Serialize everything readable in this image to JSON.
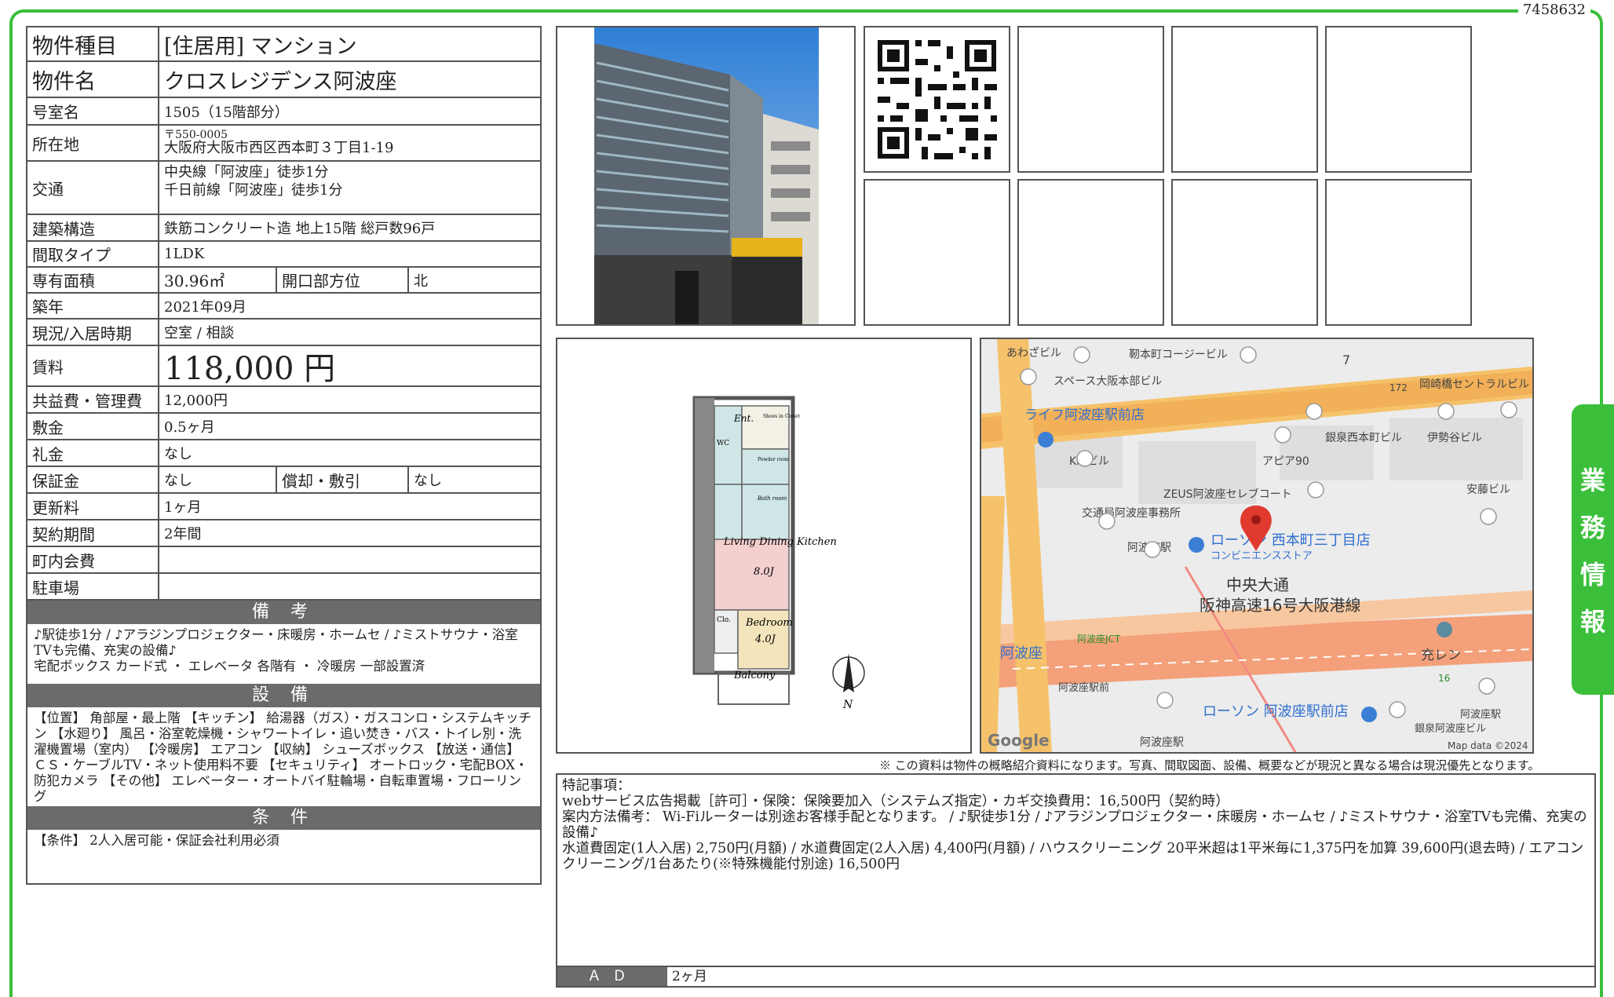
{
  "doc_id": "7458632",
  "side_tab": [
    "業",
    "務",
    "情",
    "報"
  ],
  "property": {
    "type_label": "物件種目",
    "type_value": "[住居用]  マンション",
    "name_label": "物件名",
    "name_value": "クロスレジデンス阿波座",
    "room_label": "号室名",
    "room_value": "1505（15階部分）",
    "address_label": "所在地",
    "postal": "〒550-0005",
    "address_value": "大阪府大阪市西区西本町３丁目1-19",
    "access_label": "交通",
    "access_1": "中央線「阿波座」徒歩1分",
    "access_2": "千日前線「阿波座」徒歩1分",
    "structure_label": "建築構造",
    "structure_value": "鉄筋コンクリート造  地上15階  総戸数96戸",
    "layout_label": "間取タイプ",
    "layout_value": "1LDK",
    "area_label": "専有面積",
    "area_value": "30.96㎡",
    "direction_label": "開口部方位",
    "direction_value": "北",
    "built_label": "築年",
    "built_value": "2021年09月",
    "status_label": "現況/入居時期",
    "status_value": "空室  /  相談",
    "rent_label": "賃料",
    "rent_value": "118,000  円",
    "fee_label": "共益費・管理費",
    "fee_value": "12,000円",
    "deposit_label": "敷金",
    "deposit_value": "0.5ヶ月",
    "keymoney_label": "礼金",
    "keymoney_value": "なし",
    "guarantee_label": "保証金",
    "guarantee_value": "なし",
    "amort_label": "償却・敷引",
    "amort_value": "なし",
    "renewal_label": "更新料",
    "renewal_value": "1ヶ月",
    "contract_label": "契約期間",
    "contract_value": "2年間",
    "town_label": "町内会費",
    "town_value": "",
    "parking_label": "駐車場",
    "parking_value": ""
  },
  "remarks_head": "備 考",
  "remarks_text": "♪駅徒歩1分 / ♪アラジンプロジェクター・床暖房・ホームセ / ♪ミストサウナ・浴室TVも完備、充実の設備♪\n宅配ボックス カード式 ・ エレベータ 各階有 ・ 冷暖房 一部設置済",
  "equip_head": "設 備",
  "equip_text": "【位置】 角部屋・最上階 【キッチン】 給湯器（ガス）・ガスコンロ・システムキッチン 【水廻り】 風呂・浴室乾燥機・シャワートイレ・追い焚き・バス・トイレ別・洗濯機置場（室内） 【冷暖房】 エアコン 【収納】 シューズボックス 【放送・通信】 ＣＳ・ケーブルTV・ネット使用料不要 【セキュリティ】 オートロック・宅配BOX・防犯カメラ 【その他】 エレベーター・オートバイ駐輪場・自転車置場・フローリング",
  "cond_head": "条 件",
  "cond_text": "【条件】 2人入居可能・保証会社利用必須",
  "floorplan": {
    "ent": "Ent.",
    "shoes": "Shoes in Closet",
    "wc": "WC",
    "powder": "Powder room",
    "bath": "Bath room",
    "ldk": "Living Dining Kitchen",
    "ldk_size": "8.0J",
    "cl": "Clo.",
    "bed": "Bedroom",
    "bed_size": "4.0J",
    "balcony": "Balcony",
    "north": "N"
  },
  "map": {
    "labels": [
      "あわざビル",
      "靭本町コージービル",
      "スペース大阪本部ビル",
      "7",
      "172",
      "岡崎橋セントラルビル",
      "ライフ阿波座駅前店",
      "銀泉西本町ビル",
      "伊勢谷ビル",
      "Kmビル",
      "アピア90",
      "安藤ビル",
      "ZEUS阿波座セレブコート",
      "交通局阿波座事務所",
      "阿波座駅",
      "ローソン 西本町三丁目店",
      "コンビニエンスストア",
      "中央大通",
      "阪神高速16号大阪港線",
      "阿波座JCT",
      "阿波座",
      "充レン",
      "16",
      "阿波座駅前",
      "ローソン 阿波座駅前店",
      "阿波座駅",
      "銀泉阿波座ビル",
      "阿波座駅"
    ],
    "google": "Google",
    "mapdata": "Map data ©2024"
  },
  "disclaimer": "※ この資料は物件の概略紹介資料になります。写真、間取図面、設備、概要などが現況と異なる場合は現況優先となります。",
  "special_head": "特記事項：",
  "special_lines": [
    "webサービス広告掲載［許可］・保険：保険要加入（システムズ指定）・カギ交換費用：16,500円（契約時）",
    "案内方法備考： Wi-Fiルーターは別途お客様手配となります。 / ♪駅徒歩1分 / ♪アラジンプロジェクター・床暖房・ホームセ / ♪ミストサウナ・浴室TVも完備、充実の設備♪",
    "水道費固定(1人入居) 2,750円(月額) / 水道費固定(2人入居) 4,400円(月額) / ハウスクリーニング 20平米超は1平米毎に1,375円を加算 39,600円(退去時) / エアコンクリーニング/1台あたり(※特殊機能付別途) 16,500円"
  ],
  "ad_label": "ＡＤ",
  "ad_value": "2ヶ月",
  "colors": {
    "frame": "#3bbf3b",
    "header_gray": "#6b6b6b"
  }
}
